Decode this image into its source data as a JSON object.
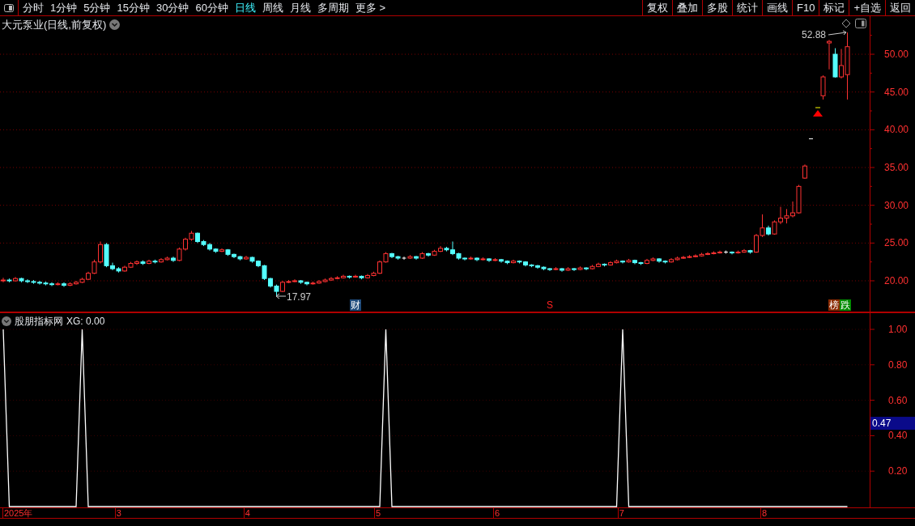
{
  "toolbar": {
    "periods": [
      {
        "label": "分时",
        "selected": false
      },
      {
        "label": "1分钟",
        "selected": false
      },
      {
        "label": "5分钟",
        "selected": false
      },
      {
        "label": "15分钟",
        "selected": false
      },
      {
        "label": "30分钟",
        "selected": false
      },
      {
        "label": "60分钟",
        "selected": false
      },
      {
        "label": "日线",
        "selected": true
      },
      {
        "label": "周线",
        "selected": false
      },
      {
        "label": "月线",
        "selected": false
      },
      {
        "label": "多周期",
        "selected": false
      },
      {
        "label": "更多 >",
        "selected": false
      }
    ],
    "actions": [
      "复权",
      "叠加",
      "多股",
      "统计",
      "画线",
      "F10",
      "标记",
      "+自选",
      "返回"
    ]
  },
  "main_chart": {
    "title": "大元泵业(日线,前复权)",
    "high_label": "52.88",
    "low_label": "17.97",
    "markers": [
      {
        "kind": "finance",
        "text": "财"
      },
      {
        "kind": "signal",
        "text": "S"
      },
      {
        "kind": "rank",
        "text": "榜"
      },
      {
        "kind": "fall",
        "text": "跌"
      }
    ],
    "chart_data": {
      "type": "candlestick",
      "grid": true,
      "ylim": [
        15.82,
        55.04
      ],
      "yticks": [
        {
          "value": 50,
          "label": "50.00"
        },
        {
          "value": 45,
          "label": "45.00"
        },
        {
          "value": 40,
          "label": "40.00"
        },
        {
          "value": 35,
          "label": "35.00"
        },
        {
          "value": 30,
          "label": "30.00"
        },
        {
          "value": 25,
          "label": "25.00"
        },
        {
          "value": 20,
          "label": "20.00"
        }
      ],
      "ohlc": [
        [
          20.0,
          20.4,
          19.8,
          20.1
        ],
        [
          20.1,
          20.3,
          19.8,
          20.0
        ],
        [
          20.0,
          20.5,
          19.9,
          20.3
        ],
        [
          20.3,
          20.4,
          19.8,
          20.0
        ],
        [
          20.0,
          20.2,
          19.7,
          19.9
        ],
        [
          19.9,
          20.1,
          19.6,
          19.8
        ],
        [
          19.8,
          20.0,
          19.5,
          19.7
        ],
        [
          19.7,
          19.9,
          19.4,
          19.6
        ],
        [
          19.6,
          19.8,
          19.3,
          19.5
        ],
        [
          19.5,
          19.8,
          19.4,
          19.6
        ],
        [
          19.6,
          19.8,
          19.2,
          19.4
        ],
        [
          19.4,
          19.8,
          19.3,
          19.6
        ],
        [
          19.6,
          20.0,
          19.5,
          19.8
        ],
        [
          19.8,
          20.4,
          19.7,
          20.2
        ],
        [
          20.2,
          21.2,
          20.1,
          21.0
        ],
        [
          21.0,
          22.8,
          20.9,
          22.5
        ],
        [
          22.5,
          25.2,
          22.3,
          24.8
        ],
        [
          24.8,
          25.0,
          21.8,
          22.0
        ],
        [
          22.0,
          22.4,
          21.4,
          21.6
        ],
        [
          21.6,
          21.8,
          21.1,
          21.3
        ],
        [
          21.3,
          22.0,
          21.2,
          21.8
        ],
        [
          21.8,
          22.5,
          21.7,
          22.3
        ],
        [
          22.3,
          22.7,
          22.1,
          22.5
        ],
        [
          22.5,
          22.7,
          22.1,
          22.3
        ],
        [
          22.3,
          22.8,
          22.2,
          22.6
        ],
        [
          22.6,
          22.8,
          22.3,
          22.5
        ],
        [
          22.5,
          23.0,
          22.4,
          22.8
        ],
        [
          22.8,
          23.2,
          22.7,
          23.0
        ],
        [
          23.0,
          23.2,
          22.5,
          22.7
        ],
        [
          22.7,
          24.4,
          22.6,
          24.2
        ],
        [
          24.2,
          25.7,
          24.0,
          25.5
        ],
        [
          25.5,
          26.6,
          25.3,
          26.3
        ],
        [
          26.3,
          26.4,
          25.0,
          25.2
        ],
        [
          25.2,
          25.4,
          24.6,
          24.8
        ],
        [
          24.8,
          25.0,
          24.0,
          24.2
        ],
        [
          24.2,
          24.3,
          23.7,
          23.9
        ],
        [
          23.9,
          24.3,
          23.8,
          24.1
        ],
        [
          24.1,
          24.2,
          23.3,
          23.5
        ],
        [
          23.5,
          23.6,
          23.0,
          23.2
        ],
        [
          23.2,
          23.3,
          22.7,
          22.9
        ],
        [
          22.9,
          23.3,
          22.8,
          23.1
        ],
        [
          23.1,
          23.2,
          22.4,
          22.6
        ],
        [
          22.6,
          22.7,
          21.8,
          22.0
        ],
        [
          22.0,
          22.1,
          20.1,
          20.3
        ],
        [
          20.3,
          20.4,
          19.1,
          19.3
        ],
        [
          19.3,
          19.5,
          17.97,
          18.6
        ],
        [
          18.6,
          20.0,
          18.5,
          19.8
        ],
        [
          19.8,
          20.1,
          19.7,
          19.9
        ],
        [
          19.9,
          20.2,
          19.8,
          20.0
        ],
        [
          20.0,
          20.1,
          19.6,
          19.8
        ],
        [
          19.8,
          19.9,
          19.4,
          19.6
        ],
        [
          19.6,
          19.9,
          19.5,
          19.7
        ],
        [
          19.7,
          20.1,
          19.6,
          19.9
        ],
        [
          19.9,
          20.3,
          19.8,
          20.1
        ],
        [
          20.1,
          20.5,
          20.0,
          20.3
        ],
        [
          20.3,
          20.6,
          20.2,
          20.4
        ],
        [
          20.4,
          20.8,
          20.3,
          20.6
        ],
        [
          20.6,
          20.7,
          20.3,
          20.5
        ],
        [
          20.5,
          20.8,
          20.4,
          20.6
        ],
        [
          20.6,
          20.7,
          20.2,
          20.4
        ],
        [
          20.4,
          20.9,
          20.3,
          20.7
        ],
        [
          20.7,
          21.2,
          20.6,
          21.0
        ],
        [
          21.0,
          22.7,
          20.9,
          22.5
        ],
        [
          22.5,
          23.8,
          22.4,
          23.6
        ],
        [
          23.6,
          23.7,
          23.0,
          23.2
        ],
        [
          23.2,
          23.3,
          22.8,
          23.0
        ],
        [
          23.0,
          23.2,
          22.8,
          23.0
        ],
        [
          23.0,
          23.4,
          22.9,
          23.2
        ],
        [
          23.2,
          23.3,
          22.8,
          23.0
        ],
        [
          23.0,
          23.8,
          22.9,
          23.6
        ],
        [
          23.6,
          23.7,
          23.2,
          23.4
        ],
        [
          23.4,
          24.1,
          23.3,
          23.9
        ],
        [
          23.9,
          24.6,
          23.8,
          24.3
        ],
        [
          24.3,
          24.5,
          23.9,
          24.1
        ],
        [
          24.1,
          25.2,
          23.4,
          23.6
        ],
        [
          23.6,
          23.7,
          22.8,
          23.0
        ],
        [
          23.0,
          23.1,
          22.7,
          22.9
        ],
        [
          22.9,
          23.2,
          22.8,
          23.0
        ],
        [
          23.0,
          23.1,
          22.6,
          22.8
        ],
        [
          22.8,
          23.1,
          22.7,
          22.9
        ],
        [
          22.9,
          23.0,
          22.5,
          22.7
        ],
        [
          22.7,
          23.0,
          22.6,
          22.8
        ],
        [
          22.8,
          22.9,
          22.4,
          22.6
        ],
        [
          22.6,
          22.7,
          22.2,
          22.4
        ],
        [
          22.4,
          22.8,
          22.3,
          22.6
        ],
        [
          22.6,
          22.7,
          22.3,
          22.5
        ],
        [
          22.5,
          22.6,
          21.9,
          22.1
        ],
        [
          22.1,
          22.2,
          21.8,
          22.0
        ],
        [
          22.0,
          22.1,
          21.6,
          21.8
        ],
        [
          21.8,
          21.9,
          21.4,
          21.6
        ],
        [
          21.6,
          21.7,
          21.3,
          21.5
        ],
        [
          21.5,
          21.8,
          21.4,
          21.6
        ],
        [
          21.6,
          21.7,
          21.2,
          21.4
        ],
        [
          21.4,
          21.8,
          21.3,
          21.6
        ],
        [
          21.6,
          21.7,
          21.3,
          21.5
        ],
        [
          21.5,
          21.9,
          21.4,
          21.7
        ],
        [
          21.7,
          21.8,
          21.4,
          21.6
        ],
        [
          21.6,
          22.1,
          21.5,
          21.9
        ],
        [
          21.9,
          22.4,
          21.8,
          22.2
        ],
        [
          22.2,
          22.3,
          21.9,
          22.1
        ],
        [
          22.1,
          22.6,
          22.0,
          22.4
        ],
        [
          22.4,
          22.8,
          22.3,
          22.6
        ],
        [
          22.6,
          22.7,
          22.3,
          22.5
        ],
        [
          22.5,
          22.9,
          22.4,
          22.7
        ],
        [
          22.7,
          22.8,
          22.2,
          22.4
        ],
        [
          22.4,
          22.5,
          22.1,
          22.3
        ],
        [
          22.3,
          22.9,
          22.2,
          22.7
        ],
        [
          22.7,
          23.1,
          22.6,
          22.9
        ],
        [
          22.9,
          23.0,
          22.4,
          22.6
        ],
        [
          22.6,
          22.7,
          22.3,
          22.5
        ],
        [
          22.5,
          23.0,
          22.4,
          22.8
        ],
        [
          22.8,
          23.2,
          22.7,
          23.0
        ],
        [
          23.0,
          23.3,
          22.9,
          23.1
        ],
        [
          23.1,
          23.4,
          23.0,
          23.2
        ],
        [
          23.2,
          23.5,
          23.1,
          23.3
        ],
        [
          23.3,
          23.7,
          23.2,
          23.5
        ],
        [
          23.5,
          23.8,
          23.4,
          23.6
        ],
        [
          23.6,
          23.9,
          23.5,
          23.7
        ],
        [
          23.7,
          24.0,
          23.6,
          23.8
        ],
        [
          23.8,
          24.0,
          23.6,
          23.8
        ],
        [
          23.8,
          23.9,
          23.5,
          23.7
        ],
        [
          23.7,
          24.0,
          23.6,
          23.8
        ],
        [
          23.8,
          24.2,
          23.7,
          24.0
        ],
        [
          24.0,
          24.1,
          23.6,
          23.8
        ],
        [
          23.8,
          26.2,
          23.7,
          26.0
        ],
        [
          26.0,
          28.8,
          25.8,
          27.0
        ],
        [
          27.0,
          27.3,
          26.0,
          26.2
        ],
        [
          26.2,
          28.0,
          26.1,
          27.8
        ],
        [
          27.8,
          29.8,
          27.5,
          28.3
        ],
        [
          28.3,
          29.5,
          27.6,
          28.6
        ],
        [
          28.6,
          30.5,
          28.4,
          29.0
        ],
        [
          29.0,
          32.7,
          28.9,
          32.5
        ],
        [
          33.6,
          35.4,
          33.5,
          35.2
        ],
        [
          38.8,
          38.8,
          38.8,
          38.8
        ],
        null,
        [
          44.5,
          47.2,
          44.0,
          47.0
        ],
        [
          51.5,
          51.9,
          48.0,
          51.7
        ],
        [
          50.0,
          50.8,
          46.9,
          47.0
        ],
        [
          47.0,
          50.7,
          46.8,
          48.5
        ],
        [
          47.3,
          52.88,
          44.0,
          51.0
        ]
      ]
    }
  },
  "indicator": {
    "name": "股朋指标网",
    "reading": "XG: 0.00",
    "cursor_value": "0.47",
    "chart_data": {
      "type": "line",
      "grid": true,
      "ylim": [
        0,
        1
      ],
      "series": [
        {
          "color": "#ffffff",
          "values": [
            1,
            0,
            0,
            0,
            0,
            0,
            0,
            0,
            0,
            0,
            0,
            0,
            0,
            1,
            0,
            0,
            0,
            0,
            0,
            0,
            0,
            0,
            0,
            0,
            0,
            0,
            0,
            0,
            0,
            0,
            0,
            0,
            0,
            0,
            0,
            0,
            0,
            0,
            0,
            0,
            0,
            0,
            0,
            0,
            0,
            0,
            0,
            0,
            0,
            0,
            0,
            0,
            0,
            0,
            0,
            0,
            0,
            0,
            0,
            0,
            0,
            0,
            0,
            1,
            0,
            0,
            0,
            0,
            0,
            0,
            0,
            0,
            0,
            0,
            0,
            0,
            0,
            0,
            0,
            0,
            0,
            0,
            0,
            0,
            0,
            0,
            0,
            0,
            0,
            0,
            0,
            0,
            0,
            0,
            0,
            0,
            0,
            0,
            0,
            0,
            0,
            0,
            1,
            0,
            0,
            0,
            0,
            0,
            0,
            0,
            0,
            0,
            0,
            0,
            0,
            0,
            0,
            0,
            0,
            0,
            0,
            0,
            0,
            0,
            0,
            0,
            0,
            0,
            0,
            0,
            0,
            0,
            0,
            0,
            0,
            0,
            0,
            0,
            0,
            0
          ]
        }
      ],
      "yticks": [
        {
          "value": 0.2,
          "label": "0.20"
        },
        {
          "value": 0.4,
          "label": "0.40"
        },
        {
          "value": 0.6,
          "label": "0.60"
        },
        {
          "value": 0.8,
          "label": "0.80"
        },
        {
          "value": 1,
          "label": "1.00"
        }
      ]
    }
  },
  "time_axis": [
    "2025年",
    "3",
    "4",
    "5",
    "6",
    "7",
    "8"
  ]
}
